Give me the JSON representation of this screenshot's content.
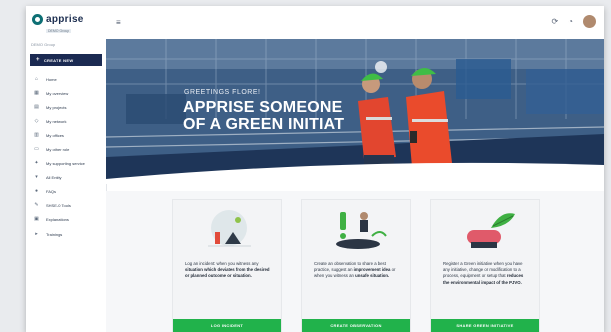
{
  "brand": {
    "name": "apprise",
    "sub": "DEMO Group"
  },
  "sidebar": {
    "tenant": "DEMO Group",
    "create_label": "CREATE NEW",
    "items": [
      {
        "label": "Home",
        "icon": "home-icon"
      },
      {
        "label": "My overview",
        "icon": "overview-icon"
      },
      {
        "label": "My projects",
        "icon": "projects-icon"
      },
      {
        "label": "My network",
        "icon": "network-icon"
      },
      {
        "label": "My offices",
        "icon": "offices-icon"
      },
      {
        "label": "My other role",
        "icon": "role-icon"
      },
      {
        "label": "My supporting service",
        "icon": "service-icon"
      },
      {
        "label": "All Entity",
        "icon": "entity-icon"
      },
      {
        "label": "FAQs",
        "icon": "faq-icon"
      },
      {
        "label": "SHSE-0 Tools",
        "icon": "tools-icon"
      },
      {
        "label": "Explanations",
        "icon": "explanations-icon"
      },
      {
        "label": "Trainings",
        "icon": "trainings-icon"
      }
    ]
  },
  "hero": {
    "greeting": "GREETINGS FLORE!",
    "headline_line1": "APPRISE SOMEONE",
    "headline_line2": "OF A GREEN INITIAT"
  },
  "cards": [
    {
      "text_pre": "Log an incident: when you witness any ",
      "text_bold1": "situation which deviates from the desired or planned outcome or situation.",
      "text_mid": "",
      "text_bold2": "",
      "cta": "LOG INCIDENT"
    },
    {
      "text_pre": "Create an observation to share a best practice, suggest an ",
      "text_bold1": "improvement idea",
      "text_mid": " or when you witness an ",
      "text_bold2": "unsafe situation.",
      "cta": "CREATE OBSERVATION"
    },
    {
      "text_pre": "Register a Green initiative when you have any initiative, change or modification to a process, equipment or setup that ",
      "text_bold1": "reduces the environmental impact of the PJVO.",
      "text_mid": "",
      "text_bold2": "",
      "cta": "SHARE GREEN INITIATIVE"
    }
  ],
  "colors": {
    "navy": "#1b2a52",
    "green": "#21b24b",
    "hero_blue": "#2f4d74",
    "logo_teal": "#0d6f74"
  }
}
